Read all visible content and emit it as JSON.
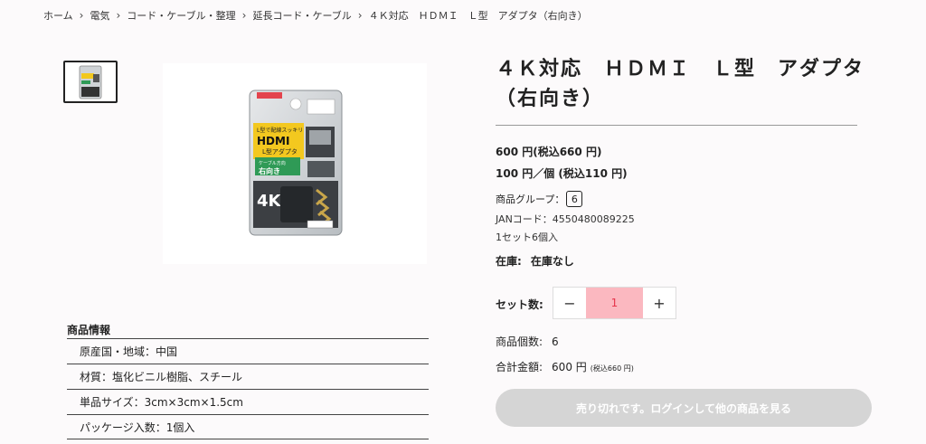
{
  "breadcrumb": [
    "ホーム",
    "電気",
    "コード・ケーブル・整理",
    "延長コード・ケーブル",
    "４Ｋ対応　ＨＤＭＩ　Ｌ型　アダプタ（右向き）"
  ],
  "product": {
    "title": "４Ｋ対応　ＨＤＭＩ　Ｌ型　アダプタ（右向き）",
    "price_set": "600 円(税込660 円)",
    "price_unit": "100 円／個 (税込110 円)",
    "group_label": "商品グループ：",
    "group_value": "6",
    "jan": "JANコード：4550480089225",
    "set_info": "1セット6個入",
    "stock_label": "在庫:",
    "stock_value": "在庫なし"
  },
  "quantity": {
    "label": "セット数:",
    "minus": "−",
    "value": "1",
    "plus": "+"
  },
  "summary": {
    "count_label": "商品個数:",
    "count_value": "6",
    "total_label": "合計金額:",
    "total_value": "600 円",
    "total_tax": "(税込660 円)"
  },
  "cta": {
    "label": "売り切れです。ログインして他の商品を見る"
  },
  "info": {
    "title": "商品情報",
    "rows": [
      "原産国・地域：中国",
      "材質：塩化ビニル樹脂、スチール",
      "単品サイズ：3cm×3cm×1.5cm",
      "パッケージ入数：1個入"
    ]
  },
  "package_text": {
    "line1": "L型で配線スッキリ",
    "brand": "HDMI",
    "line2": "L型アダプタ",
    "line3": "ケーブル方向",
    "line4": "右向き",
    "k4": "4K"
  },
  "colors": {
    "accent": "#e6354b",
    "qty_bg": "#fbb8c0",
    "cta_disabled": "#d5d5d5"
  }
}
